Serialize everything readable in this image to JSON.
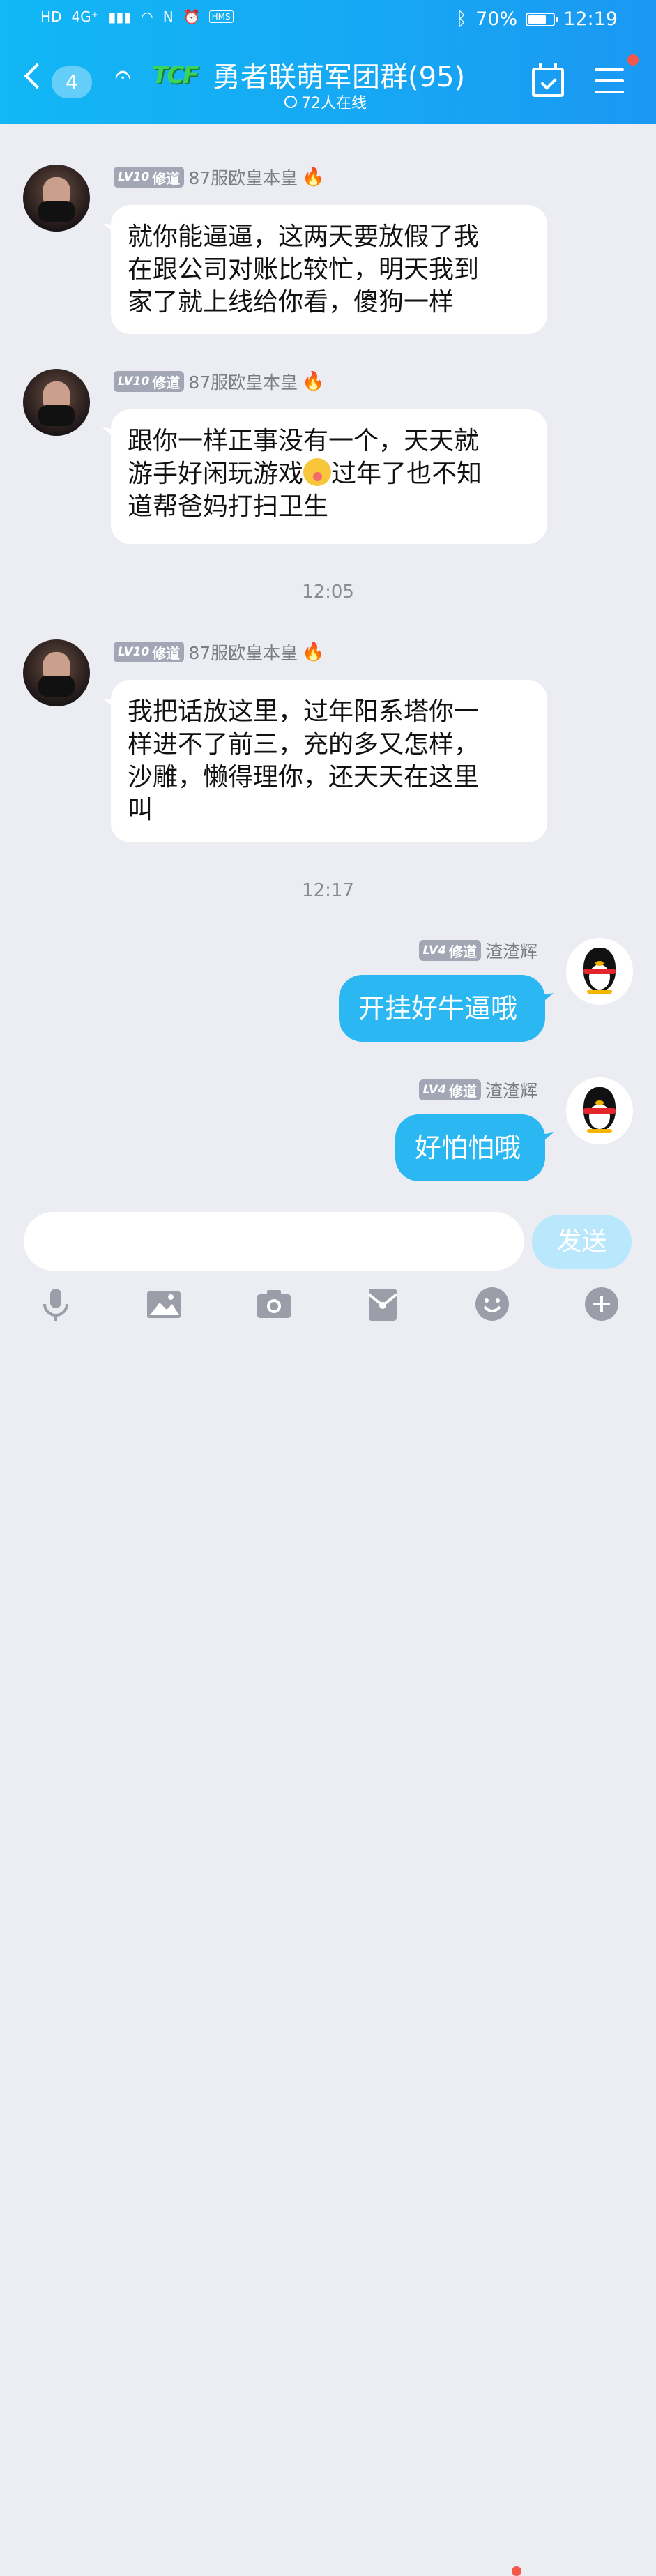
{
  "status_bar": {
    "left_icons": [
      "HD",
      "4G⁺",
      "▮▮▮",
      "wifi",
      "N",
      "alarm",
      "HMS"
    ],
    "battery": "70%",
    "time": "12:19"
  },
  "header": {
    "back_count": "4",
    "logo_text": "TCF",
    "title": "勇者联萌军团群(95)",
    "online": "72人在线"
  },
  "messages": [
    {
      "level": "LV10",
      "rank": "修道",
      "name": "87服欧皇本皇",
      "lines": [
        "就你能逼逼，这两天要放假了我",
        "在跟公司对账比较忙，明天我到",
        "家了就上线给你看，傻狗一样"
      ]
    },
    {
      "level": "LV10",
      "rank": "修道",
      "name": "87服欧皇本皇",
      "line1": "跟你一样正事没有一个，天天就",
      "line2a": "游手好闲玩游戏",
      "line2b": "过年了也不知",
      "line3": "道帮爸妈打扫卫生"
    },
    {
      "level": "LV10",
      "rank": "修道",
      "name": "87服欧皇本皇",
      "lines": [
        "我把话放这里，过年阳系塔你一",
        "样进不了前三，充的多又怎样，",
        "沙雕，懒得理你，还天天在这里",
        "叫"
      ]
    },
    {
      "level": "LV4",
      "rank": "修道",
      "name": "渣渣辉",
      "text": "开挂好牛逼哦"
    },
    {
      "level": "LV4",
      "rank": "修道",
      "name": "渣渣辉",
      "text": "好怕怕哦"
    }
  ],
  "timestamps": [
    "12:05",
    "12:17"
  ],
  "input": {
    "send_label": "发送"
  },
  "toolbar_icons": [
    "mic-icon",
    "image-icon",
    "camera-icon",
    "red-packet-icon",
    "emoji-icon",
    "plus-icon"
  ],
  "colors": {
    "header": "#12b7f5",
    "my_bubble": "#2bb8f2",
    "badge_dot": "#f5584a",
    "level_tag": "#a3a7b5"
  }
}
